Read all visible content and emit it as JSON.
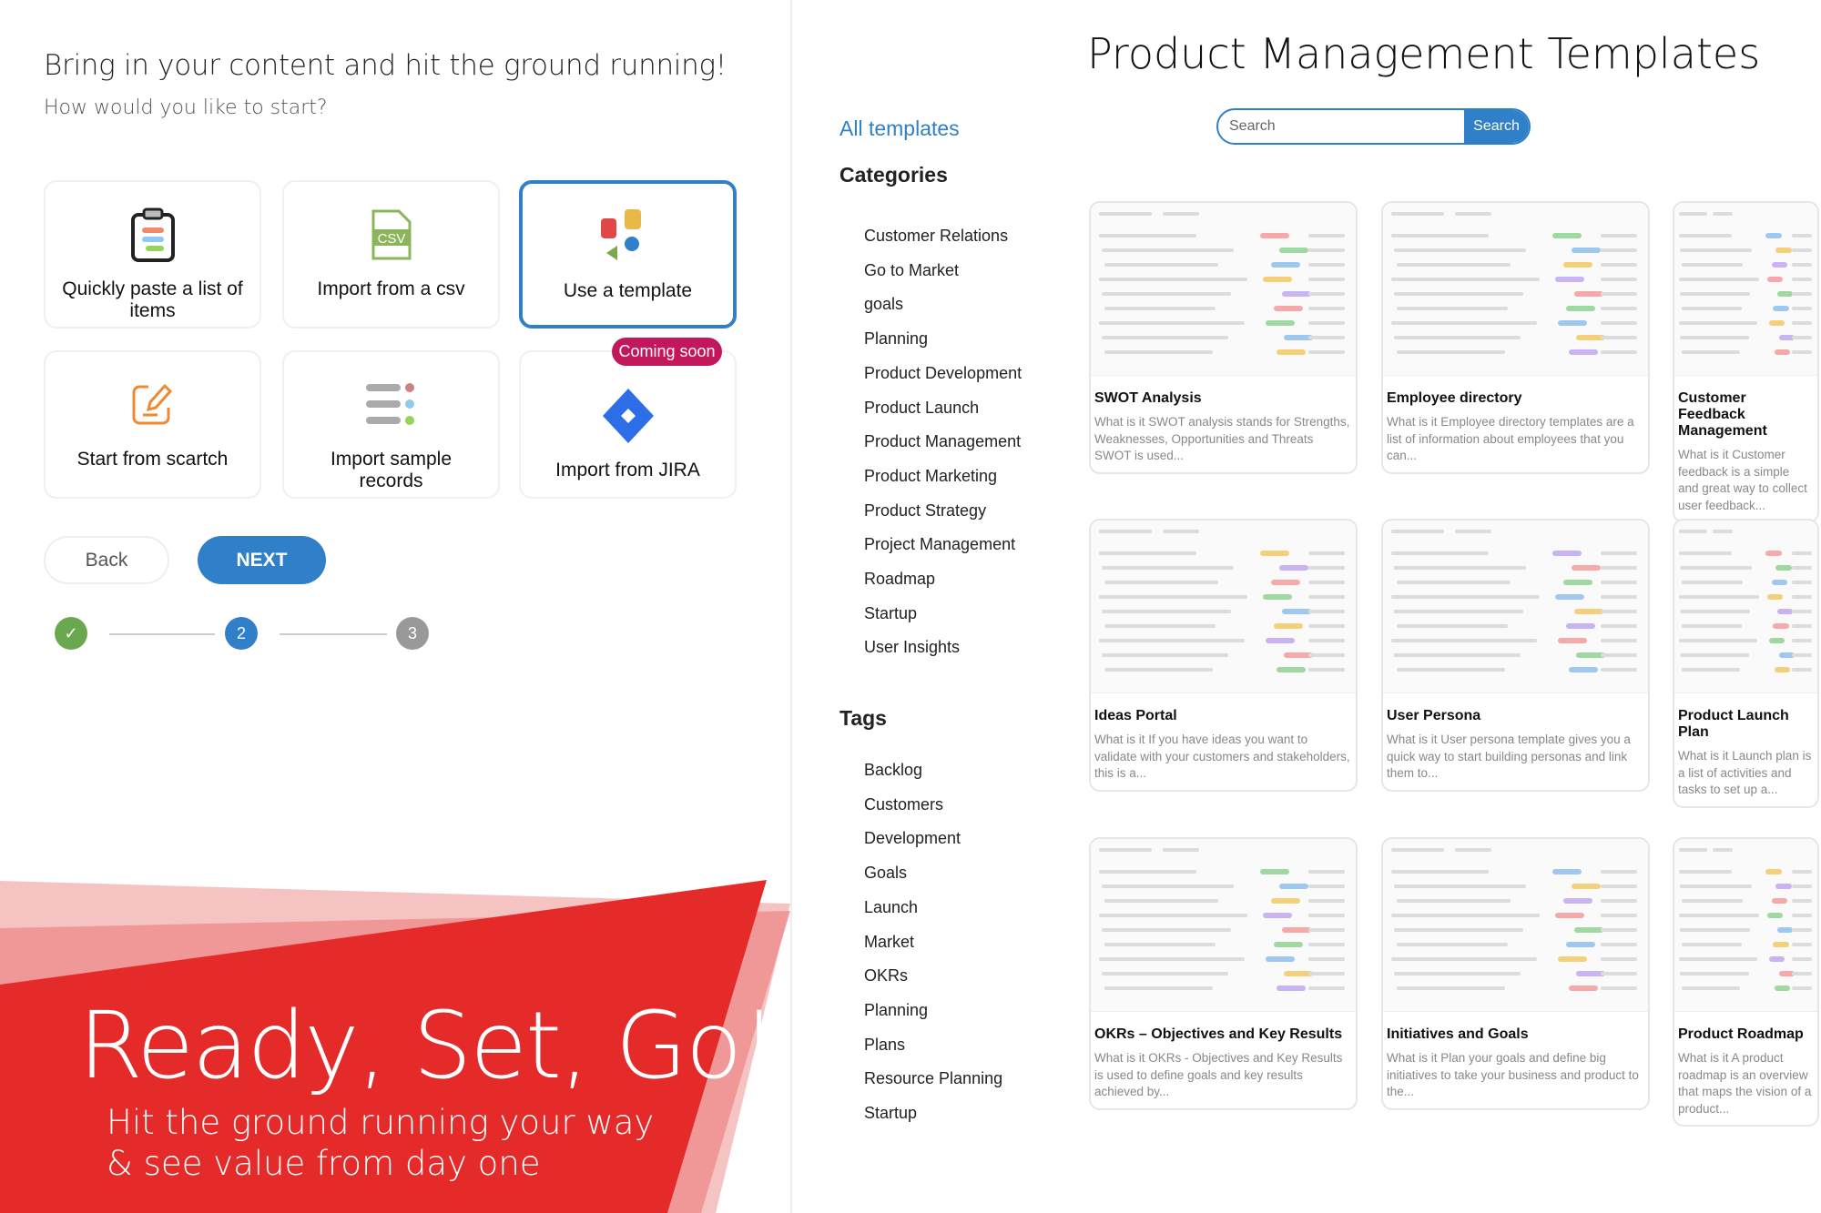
{
  "left": {
    "heading": "Bring in your content and hit the ground running!",
    "subheading": "How would you like to start?",
    "options": [
      {
        "label": "Quickly paste a list of items",
        "icon": "clipboard-list-icon",
        "selected": false
      },
      {
        "label": "Import from a csv",
        "icon": "csv-file-icon",
        "selected": false
      },
      {
        "label": "Use a template",
        "icon": "template-shapes-icon",
        "selected": true
      },
      {
        "label": "Start from scartch",
        "icon": "edit-pencil-icon",
        "selected": false
      },
      {
        "label": "Import sample records",
        "icon": "sample-records-icon",
        "selected": false
      },
      {
        "label": "Import from JIRA",
        "icon": "jira-icon",
        "selected": false
      }
    ],
    "coming_soon": "Coming soon",
    "csv_text": "CSV",
    "back_label": "Back",
    "next_label": "NEXT",
    "steps": [
      {
        "label": "✓",
        "state": "done"
      },
      {
        "label": "2",
        "state": "current"
      },
      {
        "label": "3",
        "state": "todo"
      }
    ],
    "banner": {
      "title": "Ready, Set, Go!",
      "line1": "Hit the ground running your way",
      "line2": "& see value from day one"
    }
  },
  "colors": {
    "accent": "#2f80c8",
    "badge": "#c2185b",
    "banner_red": "#e52a2a",
    "step_done": "#6aa84f",
    "step_todo": "#999999"
  },
  "right": {
    "title": "Product Management Templates",
    "all_templates": "All templates",
    "search_placeholder": "Search",
    "search_button": "Search",
    "categories_heading": "Categories",
    "categories": [
      "Customer Relations",
      "Go to Market",
      "goals",
      "Planning",
      "Product Development",
      "Product Launch",
      "Product Management",
      "Product Marketing",
      "Product Strategy",
      "Project Management",
      "Roadmap",
      "Startup",
      "User Insights"
    ],
    "tags_heading": "Tags",
    "tags": [
      "Backlog",
      "Customers",
      "Development",
      "Goals",
      "Launch",
      "Market",
      "OKRs",
      "Planning",
      "Plans",
      "Resource Planning",
      "Startup"
    ],
    "templates": [
      {
        "title": "SWOT Analysis",
        "desc": "What is it SWOT analysis stands for Strengths, Weaknesses, Opportunities and Threats SWOT is used..."
      },
      {
        "title": "Employee directory",
        "desc": "What is it  Employee directory templates are a list of information about employees that you can..."
      },
      {
        "title": "Customer Feedback Management",
        "desc": "What is it Customer feedback is a simple and great way to collect user feedback..."
      },
      {
        "title": "Ideas Portal",
        "desc": "What is it If you have ideas you want to validate with your customers and stakeholders, this is a..."
      },
      {
        "title": "User Persona",
        "desc": "What is it User persona template gives you a quick way to start building personas and link them to..."
      },
      {
        "title": "Product Launch Plan",
        "desc": "What is it Launch plan is a list of activities and tasks to set up a..."
      },
      {
        "title": "OKRs – Objectives and Key Results",
        "desc": "What is it OKRs - Objectives and Key Results is used to define goals and key results achieved by..."
      },
      {
        "title": "Initiatives and Goals",
        "desc": "What is it Plan your goals and define big initiatives to take your business and product to the..."
      },
      {
        "title": "Product Roadmap",
        "desc": "What is it A product roadmap is an overview that maps the vision of a product..."
      }
    ]
  }
}
